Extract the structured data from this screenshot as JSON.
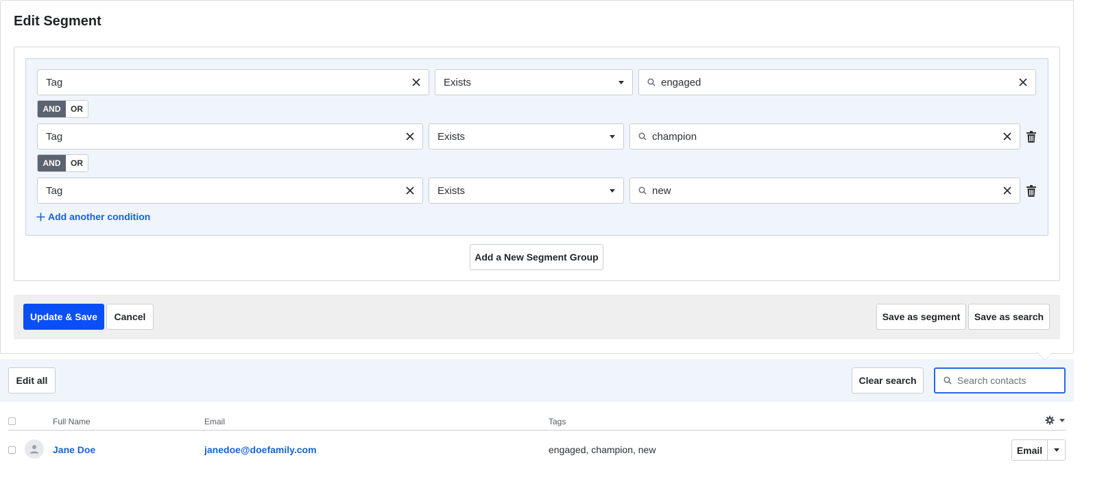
{
  "panel": {
    "title": "Edit Segment"
  },
  "conditions": [
    {
      "field": "Tag",
      "operator": "Exists",
      "value": "engaged",
      "connector": null
    },
    {
      "field": "Tag",
      "operator": "Exists",
      "value": "champion",
      "connector": {
        "and": "AND",
        "or": "OR",
        "selected": "AND"
      }
    },
    {
      "field": "Tag",
      "operator": "Exists",
      "value": "new",
      "connector": {
        "and": "AND",
        "or": "OR",
        "selected": "AND"
      }
    }
  ],
  "add_condition_label": "Add another condition",
  "add_group_label": "Add a New Segment Group",
  "footer": {
    "update_save": "Update & Save",
    "cancel": "Cancel",
    "save_as_segment": "Save as segment",
    "save_as_search": "Save as search"
  },
  "list_toolbar": {
    "edit_all": "Edit all",
    "clear_search": "Clear search",
    "search_placeholder": "Search contacts"
  },
  "table": {
    "columns": [
      "Full Name",
      "Email",
      "Tags"
    ],
    "rows": [
      {
        "name": "Jane Doe",
        "email": "janedoe@doefamily.com",
        "tags": "engaged, champion, new",
        "action": "Email"
      }
    ]
  },
  "colors": {
    "primary": "#0a4ff5",
    "link": "#1662d4",
    "group_bg": "#f0f4fb",
    "toggle_active": "#5b6270"
  }
}
